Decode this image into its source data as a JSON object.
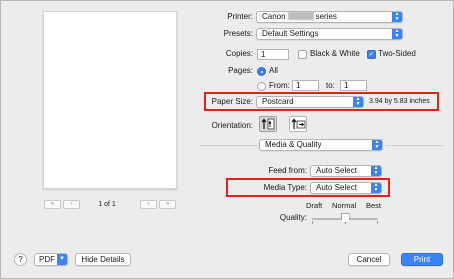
{
  "preview": {
    "nav_first": "«",
    "nav_prev": "‹",
    "nav_next": "›",
    "nav_last": "»",
    "page_indicator": "1 of 1"
  },
  "printer": {
    "label": "Printer:",
    "value_prefix": "Canon",
    "value_suffix": "series"
  },
  "presets": {
    "label": "Presets:",
    "value": "Default Settings"
  },
  "copies": {
    "label": "Copies:",
    "value": "1",
    "bw_label": "Black & White",
    "bw_checked": false,
    "two_sided_label": "Two-Sided",
    "two_sided_checked": true
  },
  "pages": {
    "label": "Pages:",
    "all_label": "All",
    "from_label": "From:",
    "from_value": "1",
    "to_label": "to:",
    "to_value": "1"
  },
  "paper_size": {
    "label": "Paper Size:",
    "value": "Postcard",
    "dimensions": "3.94 by 5.83 inches"
  },
  "orientation": {
    "label": "Orientation:"
  },
  "section": {
    "value": "Media & Quality"
  },
  "feed_from": {
    "label": "Feed from:",
    "value": "Auto Select"
  },
  "media_type": {
    "label": "Media Type:",
    "value": "Auto Select"
  },
  "quality": {
    "label": "Quality:",
    "draft": "Draft",
    "normal": "Normal",
    "best": "Best",
    "level": 0.5
  },
  "footer": {
    "help": "?",
    "pdf": "PDF",
    "hide_details": "Hide Details",
    "cancel": "Cancel",
    "print": "Print"
  },
  "colors": {
    "accent": "#3b82f6",
    "highlight": "#e2211c",
    "background": "#ececec"
  }
}
